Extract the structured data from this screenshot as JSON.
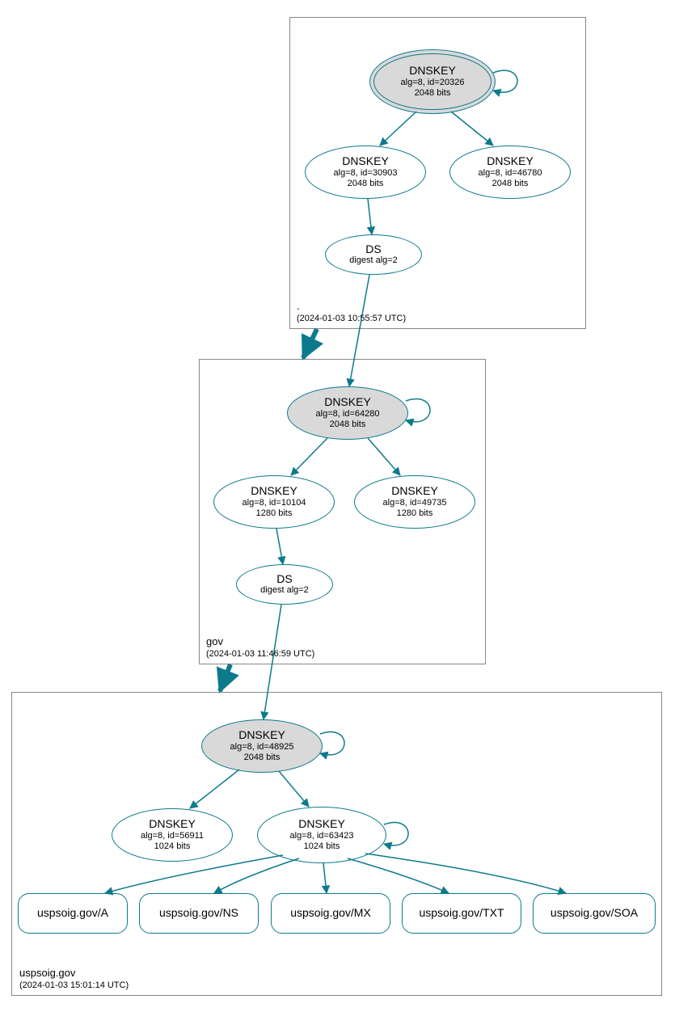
{
  "zones": {
    "root": {
      "label": ".",
      "timestamp": "(2024-01-03 10:55:57 UTC)",
      "nodes": {
        "ksk": {
          "title": "DNSKEY",
          "sub1": "alg=8, id=20326",
          "sub2": "2048 bits"
        },
        "zsk1": {
          "title": "DNSKEY",
          "sub1": "alg=8, id=30903",
          "sub2": "2048 bits"
        },
        "zsk2": {
          "title": "DNSKEY",
          "sub1": "alg=8, id=46780",
          "sub2": "2048 bits"
        },
        "ds": {
          "title": "DS",
          "sub1": "digest alg=2"
        }
      }
    },
    "gov": {
      "label": "gov",
      "timestamp": "(2024-01-03 11:46:59 UTC)",
      "nodes": {
        "ksk": {
          "title": "DNSKEY",
          "sub1": "alg=8, id=64280",
          "sub2": "2048 bits"
        },
        "zsk1": {
          "title": "DNSKEY",
          "sub1": "alg=8, id=10104",
          "sub2": "1280 bits"
        },
        "zsk2": {
          "title": "DNSKEY",
          "sub1": "alg=8, id=49735",
          "sub2": "1280 bits"
        },
        "ds": {
          "title": "DS",
          "sub1": "digest alg=2"
        }
      }
    },
    "uspsoig": {
      "label": "uspsoig.gov",
      "timestamp": "(2024-01-03 15:01:14 UTC)",
      "nodes": {
        "ksk": {
          "title": "DNSKEY",
          "sub1": "alg=8, id=48925",
          "sub2": "2048 bits"
        },
        "zsk1": {
          "title": "DNSKEY",
          "sub1": "alg=8, id=56911",
          "sub2": "1024 bits"
        },
        "zsk2": {
          "title": "DNSKEY",
          "sub1": "alg=8, id=63423",
          "sub2": "1024 bits"
        },
        "rr": {
          "a": "uspsoig.gov/A",
          "ns": "uspsoig.gov/NS",
          "mx": "uspsoig.gov/MX",
          "txt": "uspsoig.gov/TXT",
          "soa": "uspsoig.gov/SOA"
        }
      }
    }
  }
}
